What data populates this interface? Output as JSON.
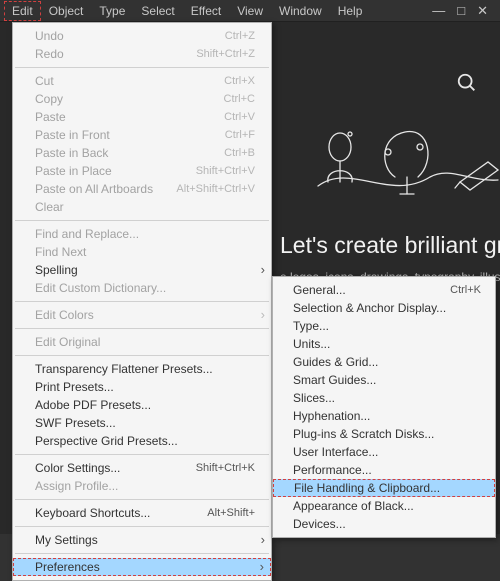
{
  "menubar": [
    "Edit",
    "Object",
    "Type",
    "Select",
    "Effect",
    "View",
    "Window",
    "Help"
  ],
  "menubar_open_index": 0,
  "background": {
    "headline": "Let's create brilliant grap",
    "subline": "e logos, icons, drawings, typography, illustratio"
  },
  "edit_menu": [
    {
      "kind": "item",
      "label": "Undo",
      "shortcut": "Ctrl+Z",
      "disabled": true
    },
    {
      "kind": "item",
      "label": "Redo",
      "shortcut": "Shift+Ctrl+Z",
      "disabled": true
    },
    {
      "kind": "sep"
    },
    {
      "kind": "item",
      "label": "Cut",
      "shortcut": "Ctrl+X",
      "disabled": true
    },
    {
      "kind": "item",
      "label": "Copy",
      "shortcut": "Ctrl+C",
      "disabled": true
    },
    {
      "kind": "item",
      "label": "Paste",
      "shortcut": "Ctrl+V",
      "disabled": true
    },
    {
      "kind": "item",
      "label": "Paste in Front",
      "shortcut": "Ctrl+F",
      "disabled": true
    },
    {
      "kind": "item",
      "label": "Paste in Back",
      "shortcut": "Ctrl+B",
      "disabled": true
    },
    {
      "kind": "item",
      "label": "Paste in Place",
      "shortcut": "Shift+Ctrl+V",
      "disabled": true
    },
    {
      "kind": "item",
      "label": "Paste on All Artboards",
      "shortcut": "Alt+Shift+Ctrl+V",
      "disabled": true
    },
    {
      "kind": "item",
      "label": "Clear",
      "disabled": true
    },
    {
      "kind": "sep"
    },
    {
      "kind": "item",
      "label": "Find and Replace...",
      "disabled": true
    },
    {
      "kind": "item",
      "label": "Find Next",
      "disabled": true
    },
    {
      "kind": "item",
      "label": "Spelling",
      "submenu": true
    },
    {
      "kind": "item",
      "label": "Edit Custom Dictionary...",
      "disabled": true
    },
    {
      "kind": "sep"
    },
    {
      "kind": "item",
      "label": "Edit Colors",
      "submenu": true,
      "disabled": true
    },
    {
      "kind": "sep"
    },
    {
      "kind": "item",
      "label": "Edit Original",
      "disabled": true
    },
    {
      "kind": "sep"
    },
    {
      "kind": "item",
      "label": "Transparency Flattener Presets..."
    },
    {
      "kind": "item",
      "label": "Print Presets..."
    },
    {
      "kind": "item",
      "label": "Adobe PDF Presets..."
    },
    {
      "kind": "item",
      "label": "SWF Presets..."
    },
    {
      "kind": "item",
      "label": "Perspective Grid Presets..."
    },
    {
      "kind": "sep"
    },
    {
      "kind": "item",
      "label": "Color Settings...",
      "shortcut": "Shift+Ctrl+K"
    },
    {
      "kind": "item",
      "label": "Assign Profile...",
      "disabled": true
    },
    {
      "kind": "sep"
    },
    {
      "kind": "item",
      "label": "Keyboard Shortcuts...",
      "shortcut": "Alt+Shift+"
    },
    {
      "kind": "sep"
    },
    {
      "kind": "item",
      "label": "My Settings",
      "submenu": true
    },
    {
      "kind": "sep"
    },
    {
      "kind": "item",
      "label": "Preferences",
      "submenu": true,
      "highlight": true
    }
  ],
  "pref_submenu": [
    {
      "kind": "item",
      "label": "General...",
      "shortcut": "Ctrl+K"
    },
    {
      "kind": "item",
      "label": "Selection & Anchor Display..."
    },
    {
      "kind": "item",
      "label": "Type..."
    },
    {
      "kind": "item",
      "label": "Units..."
    },
    {
      "kind": "item",
      "label": "Guides & Grid..."
    },
    {
      "kind": "item",
      "label": "Smart Guides..."
    },
    {
      "kind": "item",
      "label": "Slices..."
    },
    {
      "kind": "item",
      "label": "Hyphenation..."
    },
    {
      "kind": "item",
      "label": "Plug-ins & Scratch Disks..."
    },
    {
      "kind": "item",
      "label": "User Interface..."
    },
    {
      "kind": "item",
      "label": "Performance..."
    },
    {
      "kind": "item",
      "label": "File Handling & Clipboard...",
      "highlight": true
    },
    {
      "kind": "item",
      "label": "Appearance of Black..."
    },
    {
      "kind": "item",
      "label": "Devices..."
    }
  ]
}
